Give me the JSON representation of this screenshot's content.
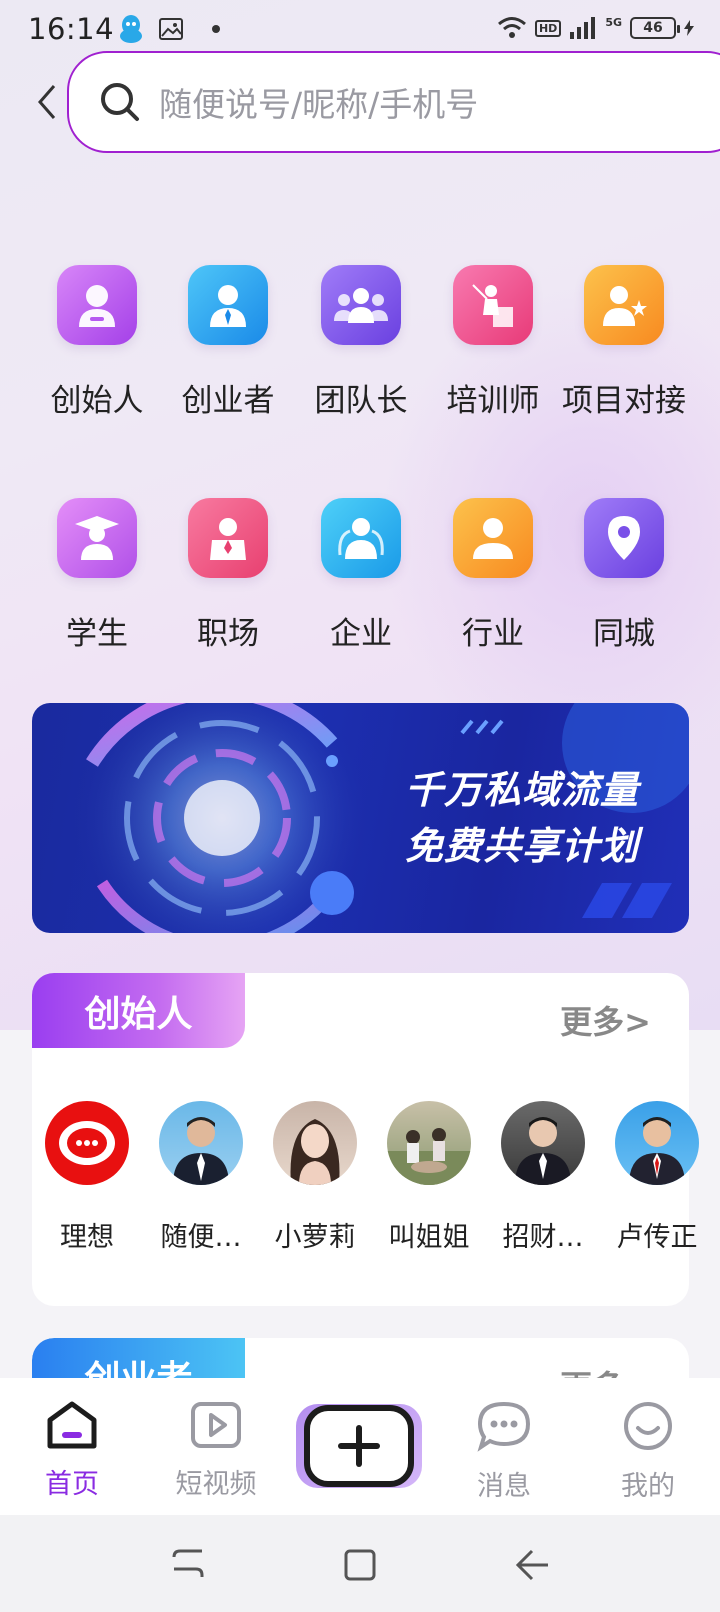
{
  "status_bar": {
    "time": "16:14",
    "battery": "46",
    "network": "5G",
    "hd": "HD"
  },
  "search": {
    "placeholder": "随便说号/昵称/手机号"
  },
  "categories": [
    {
      "label": "创始人",
      "icon": "founder-icon",
      "color": "#b65af0"
    },
    {
      "label": "创业者",
      "icon": "entrepreneur-icon",
      "color": "#2aa8f0"
    },
    {
      "label": "团队长",
      "icon": "team-leader-icon",
      "color": "#8a5cf0"
    },
    {
      "label": "培训师",
      "icon": "trainer-icon",
      "color": "#f0508a"
    },
    {
      "label": "项目对接",
      "icon": "project-icon",
      "color": "#f8a030"
    },
    {
      "label": "学生",
      "icon": "student-icon",
      "color": "#c060f0"
    },
    {
      "label": "职场",
      "icon": "workplace-icon",
      "color": "#f05080"
    },
    {
      "label": "企业",
      "icon": "enterprise-icon",
      "color": "#30a8f0"
    },
    {
      "label": "行业",
      "icon": "industry-icon",
      "color": "#f8a030"
    },
    {
      "label": "同城",
      "icon": "location-icon",
      "color": "#8a5cf0"
    }
  ],
  "banner": {
    "line1": "千万私域流量",
    "line2": "免费共享计划"
  },
  "section1": {
    "title": "创始人",
    "more": "更多>",
    "people": [
      {
        "name": "理想"
      },
      {
        "name": "随便…"
      },
      {
        "name": "小萝莉"
      },
      {
        "name": "叫姐姐"
      },
      {
        "name": "招财…"
      },
      {
        "name": "卢传正"
      }
    ]
  },
  "section2": {
    "title": "创业者",
    "more": "更多>"
  },
  "bottom_nav": {
    "home": "首页",
    "video": "短视频",
    "messages": "消息",
    "me": "我的"
  }
}
